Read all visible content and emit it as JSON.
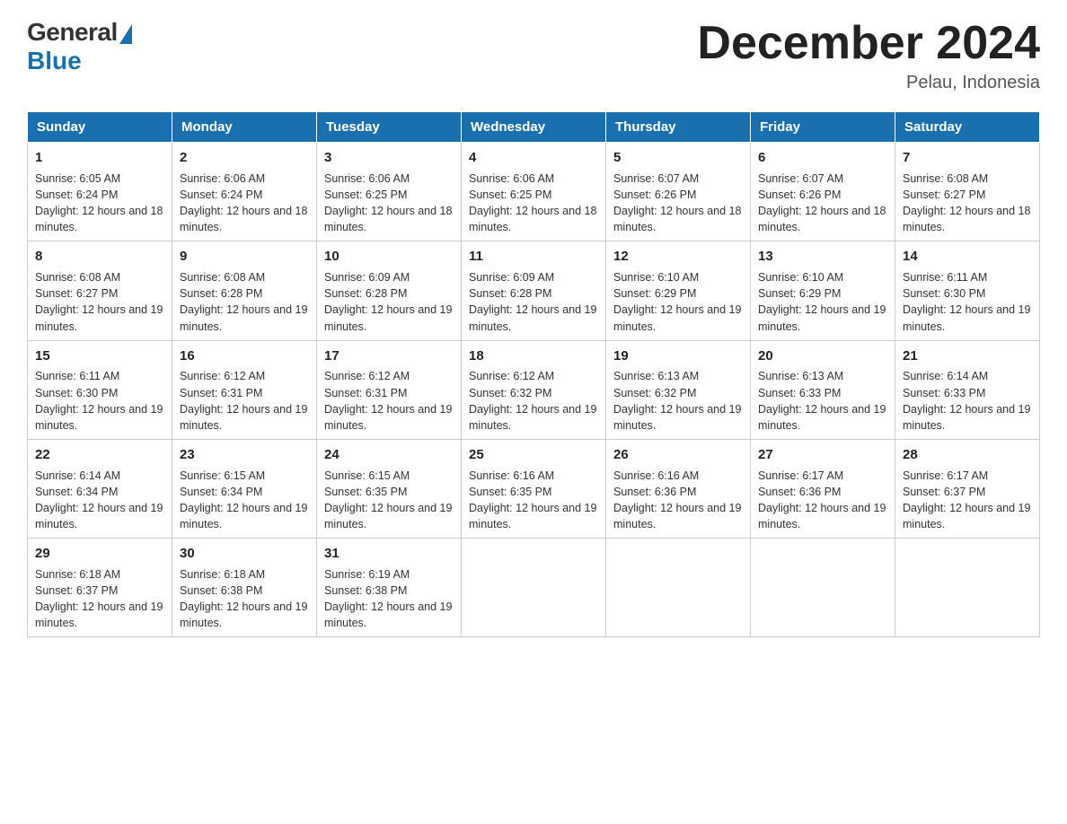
{
  "header": {
    "logo_general": "General",
    "logo_blue": "Blue",
    "title": "December 2024",
    "location": "Pelau, Indonesia"
  },
  "days_of_week": [
    "Sunday",
    "Monday",
    "Tuesday",
    "Wednesday",
    "Thursday",
    "Friday",
    "Saturday"
  ],
  "weeks": [
    [
      {
        "day": "1",
        "sunrise": "6:05 AM",
        "sunset": "6:24 PM",
        "daylight": "12 hours and 18 minutes."
      },
      {
        "day": "2",
        "sunrise": "6:06 AM",
        "sunset": "6:24 PM",
        "daylight": "12 hours and 18 minutes."
      },
      {
        "day": "3",
        "sunrise": "6:06 AM",
        "sunset": "6:25 PM",
        "daylight": "12 hours and 18 minutes."
      },
      {
        "day": "4",
        "sunrise": "6:06 AM",
        "sunset": "6:25 PM",
        "daylight": "12 hours and 18 minutes."
      },
      {
        "day": "5",
        "sunrise": "6:07 AM",
        "sunset": "6:26 PM",
        "daylight": "12 hours and 18 minutes."
      },
      {
        "day": "6",
        "sunrise": "6:07 AM",
        "sunset": "6:26 PM",
        "daylight": "12 hours and 18 minutes."
      },
      {
        "day": "7",
        "sunrise": "6:08 AM",
        "sunset": "6:27 PM",
        "daylight": "12 hours and 18 minutes."
      }
    ],
    [
      {
        "day": "8",
        "sunrise": "6:08 AM",
        "sunset": "6:27 PM",
        "daylight": "12 hours and 19 minutes."
      },
      {
        "day": "9",
        "sunrise": "6:08 AM",
        "sunset": "6:28 PM",
        "daylight": "12 hours and 19 minutes."
      },
      {
        "day": "10",
        "sunrise": "6:09 AM",
        "sunset": "6:28 PM",
        "daylight": "12 hours and 19 minutes."
      },
      {
        "day": "11",
        "sunrise": "6:09 AM",
        "sunset": "6:28 PM",
        "daylight": "12 hours and 19 minutes."
      },
      {
        "day": "12",
        "sunrise": "6:10 AM",
        "sunset": "6:29 PM",
        "daylight": "12 hours and 19 minutes."
      },
      {
        "day": "13",
        "sunrise": "6:10 AM",
        "sunset": "6:29 PM",
        "daylight": "12 hours and 19 minutes."
      },
      {
        "day": "14",
        "sunrise": "6:11 AM",
        "sunset": "6:30 PM",
        "daylight": "12 hours and 19 minutes."
      }
    ],
    [
      {
        "day": "15",
        "sunrise": "6:11 AM",
        "sunset": "6:30 PM",
        "daylight": "12 hours and 19 minutes."
      },
      {
        "day": "16",
        "sunrise": "6:12 AM",
        "sunset": "6:31 PM",
        "daylight": "12 hours and 19 minutes."
      },
      {
        "day": "17",
        "sunrise": "6:12 AM",
        "sunset": "6:31 PM",
        "daylight": "12 hours and 19 minutes."
      },
      {
        "day": "18",
        "sunrise": "6:12 AM",
        "sunset": "6:32 PM",
        "daylight": "12 hours and 19 minutes."
      },
      {
        "day": "19",
        "sunrise": "6:13 AM",
        "sunset": "6:32 PM",
        "daylight": "12 hours and 19 minutes."
      },
      {
        "day": "20",
        "sunrise": "6:13 AM",
        "sunset": "6:33 PM",
        "daylight": "12 hours and 19 minutes."
      },
      {
        "day": "21",
        "sunrise": "6:14 AM",
        "sunset": "6:33 PM",
        "daylight": "12 hours and 19 minutes."
      }
    ],
    [
      {
        "day": "22",
        "sunrise": "6:14 AM",
        "sunset": "6:34 PM",
        "daylight": "12 hours and 19 minutes."
      },
      {
        "day": "23",
        "sunrise": "6:15 AM",
        "sunset": "6:34 PM",
        "daylight": "12 hours and 19 minutes."
      },
      {
        "day": "24",
        "sunrise": "6:15 AM",
        "sunset": "6:35 PM",
        "daylight": "12 hours and 19 minutes."
      },
      {
        "day": "25",
        "sunrise": "6:16 AM",
        "sunset": "6:35 PM",
        "daylight": "12 hours and 19 minutes."
      },
      {
        "day": "26",
        "sunrise": "6:16 AM",
        "sunset": "6:36 PM",
        "daylight": "12 hours and 19 minutes."
      },
      {
        "day": "27",
        "sunrise": "6:17 AM",
        "sunset": "6:36 PM",
        "daylight": "12 hours and 19 minutes."
      },
      {
        "day": "28",
        "sunrise": "6:17 AM",
        "sunset": "6:37 PM",
        "daylight": "12 hours and 19 minutes."
      }
    ],
    [
      {
        "day": "29",
        "sunrise": "6:18 AM",
        "sunset": "6:37 PM",
        "daylight": "12 hours and 19 minutes."
      },
      {
        "day": "30",
        "sunrise": "6:18 AM",
        "sunset": "6:38 PM",
        "daylight": "12 hours and 19 minutes."
      },
      {
        "day": "31",
        "sunrise": "6:19 AM",
        "sunset": "6:38 PM",
        "daylight": "12 hours and 19 minutes."
      },
      null,
      null,
      null,
      null
    ]
  ]
}
